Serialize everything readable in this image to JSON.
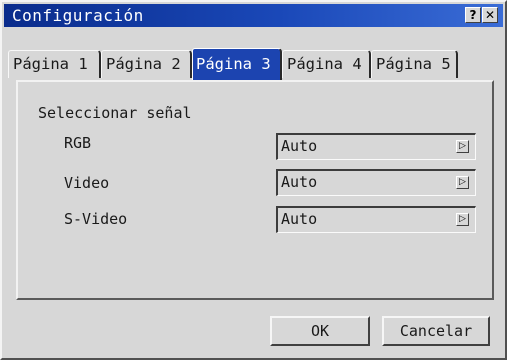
{
  "window": {
    "title": "Configuración",
    "help_icon_glyph": "?",
    "close_icon_glyph": "✕"
  },
  "tabs": [
    {
      "label": "Página 1",
      "active": false
    },
    {
      "label": "Página 2",
      "active": false
    },
    {
      "label": "Página 3",
      "active": true
    },
    {
      "label": "Página 4",
      "active": false
    },
    {
      "label": "Página 5",
      "active": false
    }
  ],
  "panel": {
    "section_label": "Seleccionar señal",
    "rows": [
      {
        "label": "RGB",
        "value": "Auto",
        "icon": "dropdown-arrow-icon"
      },
      {
        "label": "Video",
        "value": "Auto",
        "icon": "dropdown-arrow-icon"
      },
      {
        "label": "S-Video",
        "value": "Auto",
        "icon": "dropdown-arrow-icon"
      }
    ],
    "arrow_glyph": "▷"
  },
  "buttons": {
    "ok_label": "OK",
    "cancel_label": "Cancelar"
  },
  "colors": {
    "titlebar": "#1a48b8",
    "active_tab": "#1c44b0",
    "window_bg": "#d7d7d7"
  }
}
